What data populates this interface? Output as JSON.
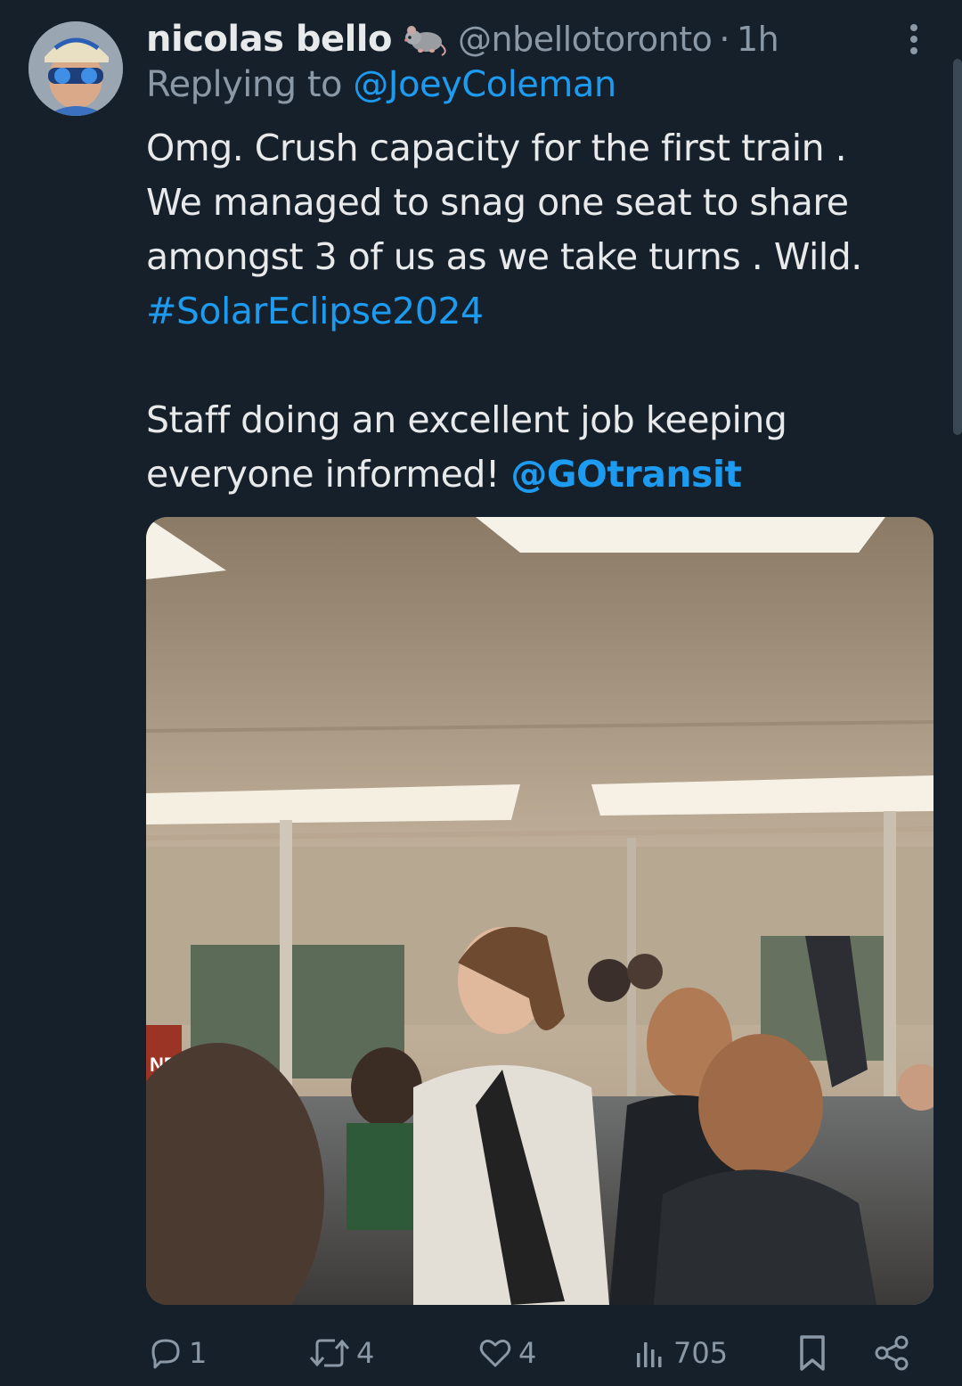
{
  "tweet": {
    "display_name": "nicolas bello",
    "handle": "@nbellotoronto",
    "separator": "·",
    "time": "1h",
    "replying_prefix": "Replying to",
    "replying_to": "@JoeyColeman",
    "lines": [
      "Omg. Crush capacity for the first train .",
      "We managed to snag one seat to share",
      "amongst 3 of us as we take turns . Wild."
    ],
    "hashtag": "#SolarEclipse2024",
    "line5": "Staff doing an excellent job keeping",
    "line6_prefix": "everyone informed!",
    "line6_mention": "@GOtransit",
    "media_sign_text": "NE"
  },
  "actions": {
    "replies": "1",
    "retweets": "4",
    "likes": "4",
    "views": "705"
  },
  "icons": {
    "badge": "rat-icon",
    "more": "more-vertical-icon",
    "reply": "reply-icon",
    "retweet": "retweet-icon",
    "like": "heart-icon",
    "views": "views-icon",
    "bookmark": "bookmark-icon",
    "share": "share-icon"
  },
  "colors": {
    "background": "#15202b",
    "link": "#1d9bf0",
    "muted": "#8b98a5",
    "text": "#e7e9ea"
  }
}
